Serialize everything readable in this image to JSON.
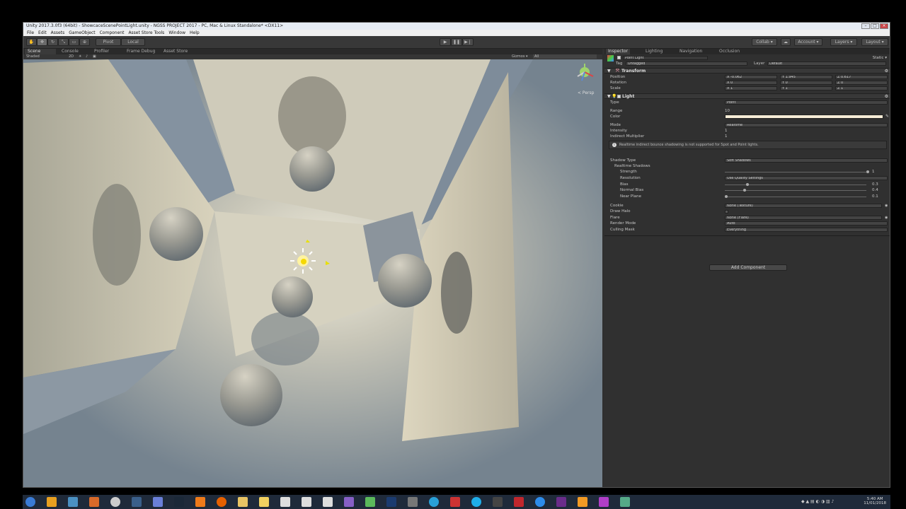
{
  "window": {
    "title": "Unity 2017.3.0f3 (64bit) - ShowcaceScenePointLight.unity - NGSS PROJECT 2017 - PC, Mac & Linux Standalone* <DX11>"
  },
  "menu": [
    "File",
    "Edit",
    "Assets",
    "GameObject",
    "Component",
    "Asset Store Tools",
    "Window",
    "Help"
  ],
  "toolbar": {
    "pivot": "Pivot",
    "local": "Local",
    "collab": "Collab ▾",
    "account": "Account ▾",
    "layers": "Layers ▾",
    "layout": "Layout ▾"
  },
  "scene_tabs": [
    "Scene",
    "Console",
    "Profiler",
    "Frame Debug",
    "Asset Store"
  ],
  "scene_sub": {
    "shading": "Shaded",
    "mode": "2D",
    "gizmos": "Gizmos ▾",
    "search": "All"
  },
  "gizmo": {
    "label": "< Persp"
  },
  "inspector": {
    "tabs": [
      "Inspector",
      "Lighting",
      "Navigation",
      "Occlusion"
    ],
    "object_name": "Point Light",
    "static_label": "Static ▾",
    "tag_label": "Tag",
    "tag_value": "Untagged",
    "layer_label": "Layer",
    "layer_value": "Default",
    "transform": {
      "header": "Transform",
      "position_label": "Position",
      "rotation_label": "Rotation",
      "scale_label": "Scale",
      "position": [
        "X -0.062",
        "Y 1.945",
        "Z 0.617"
      ],
      "rotation": [
        "X 0",
        "Y 0",
        "Z 0"
      ],
      "scale": [
        "X 1",
        "Y 1",
        "Z 1"
      ]
    },
    "light": {
      "header": "Light",
      "type_label": "Type",
      "type_value": "Point",
      "range_label": "Range",
      "range_value": "10",
      "color_label": "Color",
      "color_value": "#f6ecd6",
      "mode_label": "Mode",
      "mode_value": "Realtime",
      "intensity_label": "Intensity",
      "intensity_value": "1",
      "indirect_label": "Indirect Multiplier",
      "indirect_value": "1",
      "info_text": "Realtime indirect bounce shadowing is not supported for Spot and Point lights.",
      "shadow_type_label": "Shadow Type",
      "shadow_type_value": "Soft Shadows",
      "realtime_shadows_label": "Realtime Shadows",
      "strength_label": "Strength",
      "strength_value": "1",
      "resolution_label": "Resolution",
      "resolution_value": "Use Quality Settings",
      "bias_label": "Bias",
      "bias_value": "0.3",
      "normal_bias_label": "Normal Bias",
      "normal_bias_value": "0.4",
      "near_plane_label": "Near Plane",
      "near_plane_value": "0.1",
      "cookie_label": "Cookie",
      "cookie_value": "None (Texture)",
      "draw_halo_label": "Draw Halo",
      "flare_label": "Flare",
      "flare_value": "None (Flare)",
      "render_mode_label": "Render Mode",
      "render_mode_value": "Auto",
      "culling_mask_label": "Culling Mask",
      "culling_mask_value": "Everything"
    },
    "add_component": "Add Component"
  },
  "taskbar": {
    "time": "5:40 AM",
    "date": "11/01/2018"
  }
}
